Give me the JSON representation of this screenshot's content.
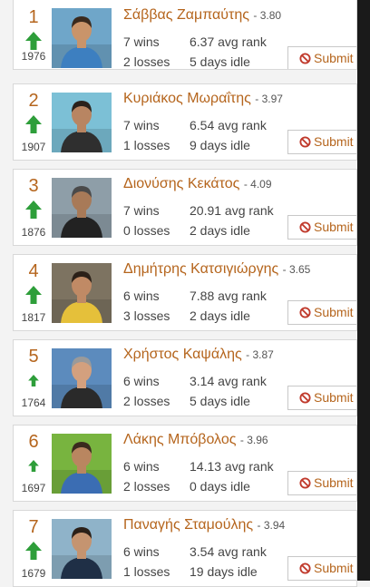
{
  "colors": {
    "accent": "#b5651d",
    "arrow_up": "#2e9e3a",
    "ban_icon": "#c0392b"
  },
  "submit_label": "Submit",
  "players": [
    {
      "position": "1",
      "name": "Σάββας Ζαμπαύτης",
      "score": "- 3.80",
      "rating": "1976",
      "wins": "7 wins",
      "losses": "2 losses",
      "avg_rank": "6.37 avg rank",
      "idle": "5 days idle",
      "trend_icon": "up-arrow-icon",
      "arrow_size": "large"
    },
    {
      "position": "2",
      "name": "Κυριάκος Μωραΐτης",
      "score": "- 3.97",
      "rating": "1907",
      "wins": "7 wins",
      "losses": "1 losses",
      "avg_rank": "6.54 avg rank",
      "idle": "9 days idle",
      "trend_icon": "up-arrow-icon",
      "arrow_size": "large"
    },
    {
      "position": "3",
      "name": "Διονύσης Κεκάτος",
      "score": "- 4.09",
      "rating": "1876",
      "wins": "7 wins",
      "losses": "0 losses",
      "avg_rank": "20.91 avg rank",
      "idle": "2 days idle",
      "trend_icon": "up-arrow-icon",
      "arrow_size": "large"
    },
    {
      "position": "4",
      "name": "Δημήτρης Κατσιγιώργης",
      "score": "- 3.65",
      "rating": "1817",
      "wins": "6 wins",
      "losses": "3 losses",
      "avg_rank": "7.88 avg rank",
      "idle": "2 days idle",
      "trend_icon": "up-arrow-icon",
      "arrow_size": "large"
    },
    {
      "position": "5",
      "name": "Χρήστος Καψάλης",
      "score": "- 3.87",
      "rating": "1764",
      "wins": "6 wins",
      "losses": "2 losses",
      "avg_rank": "3.14 avg rank",
      "idle": "5 days idle",
      "trend_icon": "up-arrow-icon",
      "arrow_size": "small"
    },
    {
      "position": "6",
      "name": "Λάκης Μπόβολος",
      "score": "- 3.96",
      "rating": "1697",
      "wins": "6 wins",
      "losses": "2 losses",
      "avg_rank": "14.13 avg rank",
      "idle": "0 days idle",
      "trend_icon": "up-arrow-icon",
      "arrow_size": "small"
    },
    {
      "position": "7",
      "name": "Παναγής Σταμούλης",
      "score": "- 3.94",
      "rating": "1679",
      "wins": "6 wins",
      "losses": "1 losses",
      "avg_rank": "3.54 avg rank",
      "idle": "19 days idle",
      "trend_icon": "up-arrow-icon",
      "arrow_size": "large"
    }
  ]
}
